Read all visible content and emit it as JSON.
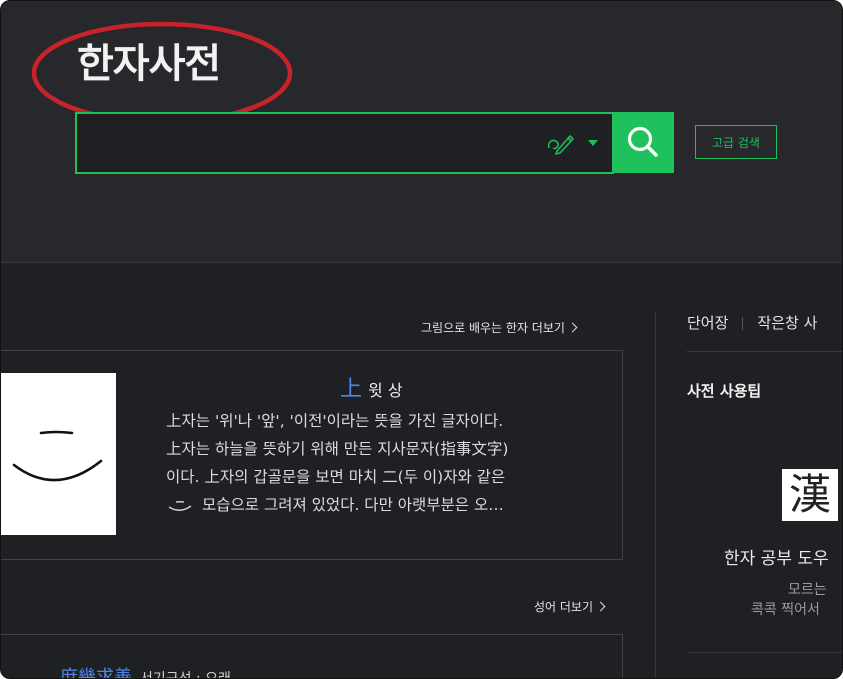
{
  "header": {
    "title": "한자사전",
    "search": {
      "placeholder": "",
      "value": ""
    },
    "icons": {
      "handwriting": "handwriting-pen-icon",
      "caret": "chevron-down-icon",
      "search": "search-icon"
    },
    "advanced_search_label": "고급 검색"
  },
  "learn_section": {
    "more_label": "그림으로 배우는 한자 더보기",
    "hanja": "上",
    "meaning": "윗 상",
    "desc_lines": [
      "上자는 '위'나 '앞', '이전'이라는 뜻을 가진 글자이다.",
      "上자는 하늘을 뜻하기 위해 만든 지사문자(指事文字)",
      "이다. 上자의 갑골문을 보면 마치 二(두 이)자와 같은",
      "모습으로 그려져 있었다. 다만 아랫부분은 오…"
    ]
  },
  "idiom_section": {
    "more_label": "성어 더보기",
    "idiom": "庶幾求善",
    "idiom_rest": "서기구선 : 오래…"
  },
  "sidebar": {
    "links": [
      "단어장",
      "작은창 사"
    ],
    "tips_heading": "사전 사용팁",
    "logo_char": "漢",
    "study_title": "한자 공부 도우",
    "study_sub": [
      "모르는",
      "콕콕 찍어서"
    ]
  },
  "colors": {
    "accent": "#1fc15c",
    "link_blue": "#4d86f0",
    "background": "#1f2023",
    "header_bg": "#27282c",
    "annotation_red": "#c8232b"
  }
}
